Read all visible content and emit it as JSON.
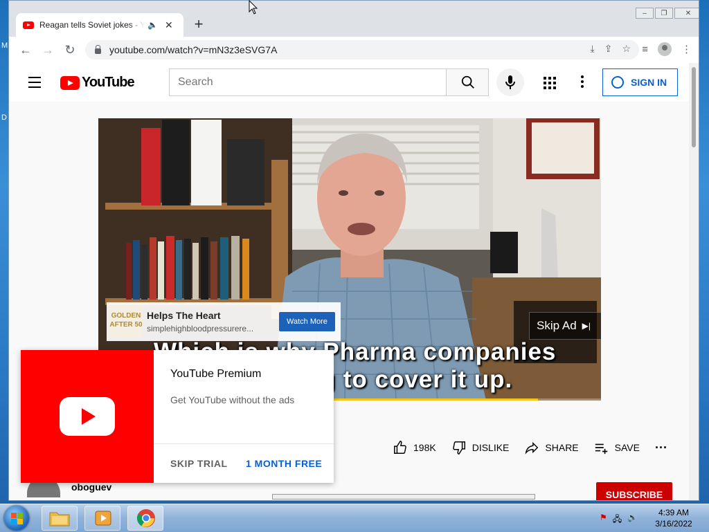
{
  "desktop": {
    "left_letters": [
      "M",
      "D"
    ]
  },
  "tab": {
    "title": "Reagan tells Soviet jokes - YouTube",
    "audio_icon": "speaker-icon",
    "close": "✕"
  },
  "new_tab": "+",
  "window_controls": [
    "‒",
    "❐",
    "✕"
  ],
  "address_bar": {
    "url": "youtube.com/watch?v=mN3z3eSVG7A"
  },
  "youtube": {
    "search_placeholder": "Search",
    "sign_in": "SIGN IN"
  },
  "video": {
    "ad": {
      "logo_line1": "GOLDEN",
      "logo_line2": "AFTER 50",
      "title": "Helps The Heart",
      "url": "simplehighbloodpressurere...",
      "button": "Watch More"
    },
    "skip_ad": "Skip Ad",
    "caption_line1": "Which is why Pharma companies",
    "caption_line2": "are scrambling to cover it up.",
    "progress": 0.875
  },
  "actions": {
    "likes": "198K",
    "dislike": "DISLIKE",
    "share": "SHARE",
    "save": "SAVE"
  },
  "channel": {
    "name": "oboguev",
    "subscribe": "SUBSCRIBE"
  },
  "promo": {
    "title": "YouTube Premium",
    "subtitle": "Get YouTube without the ads",
    "skip": "SKIP TRIAL",
    "free": "1 MONTH FREE"
  },
  "taskbar": {
    "time": "4:39 AM",
    "date": "3/16/2022"
  },
  "colors": {
    "youtube_red": "#ff0000",
    "link_blue": "#065fd4",
    "ad_button": "#1c62b9",
    "progress": "#f5c518"
  }
}
